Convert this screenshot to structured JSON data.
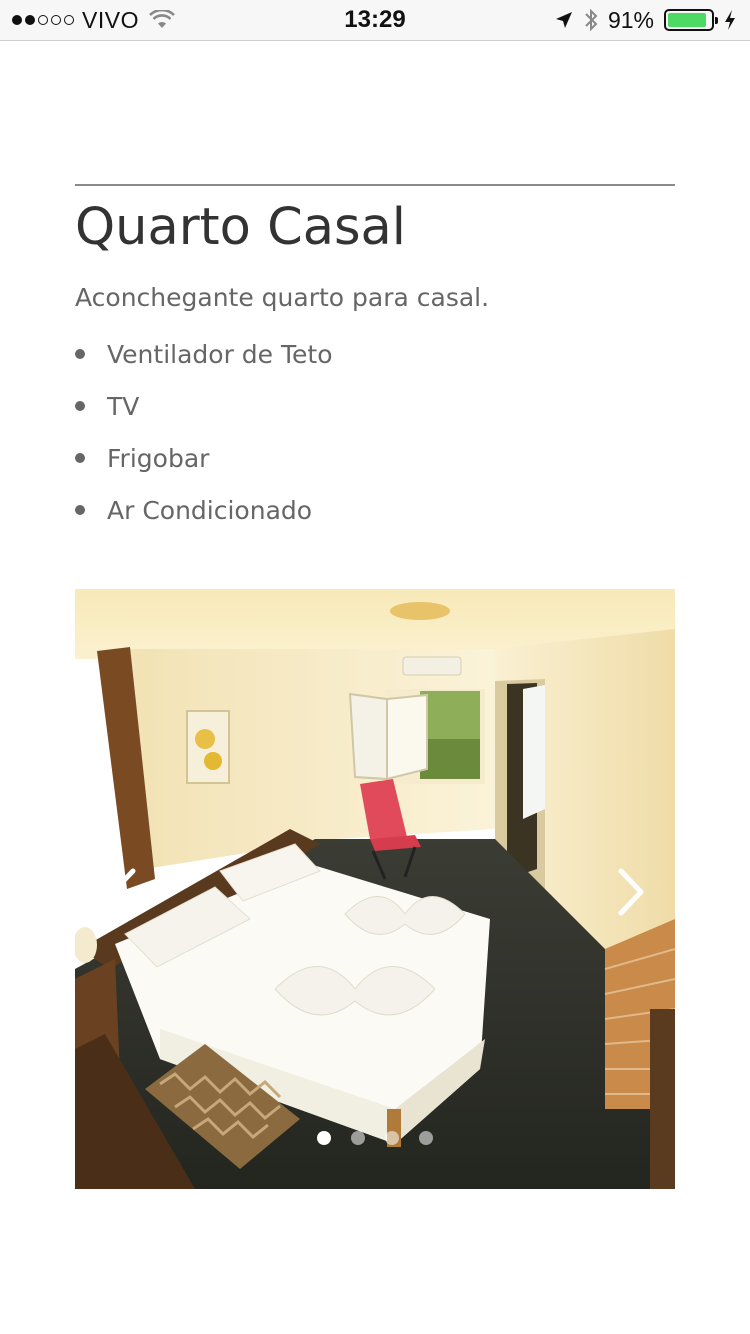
{
  "status_bar": {
    "carrier": "VIVO",
    "time": "13:29",
    "battery_percent": "91%",
    "battery_level": 0.91,
    "signal_bars_filled": 2,
    "signal_bars_total": 5,
    "icons": [
      "wifi-icon",
      "location-arrow-icon",
      "bluetooth-icon",
      "battery-icon",
      "charging-icon"
    ]
  },
  "room": {
    "title": "Quarto Casal",
    "description": "Aconchegante quarto para casal.",
    "amenities": [
      "Ventilador de Teto",
      "TV",
      "Frigobar",
      "Ar Condicionado"
    ]
  },
  "carousel": {
    "slide_count": 4,
    "active_index": 0,
    "prev_icon": "chevron-left-icon",
    "next_icon": "chevron-right-icon"
  },
  "colors": {
    "battery_green": "#4cd964",
    "text_dark": "#333333",
    "text_muted": "#666666",
    "divider": "#8a8a8a"
  }
}
